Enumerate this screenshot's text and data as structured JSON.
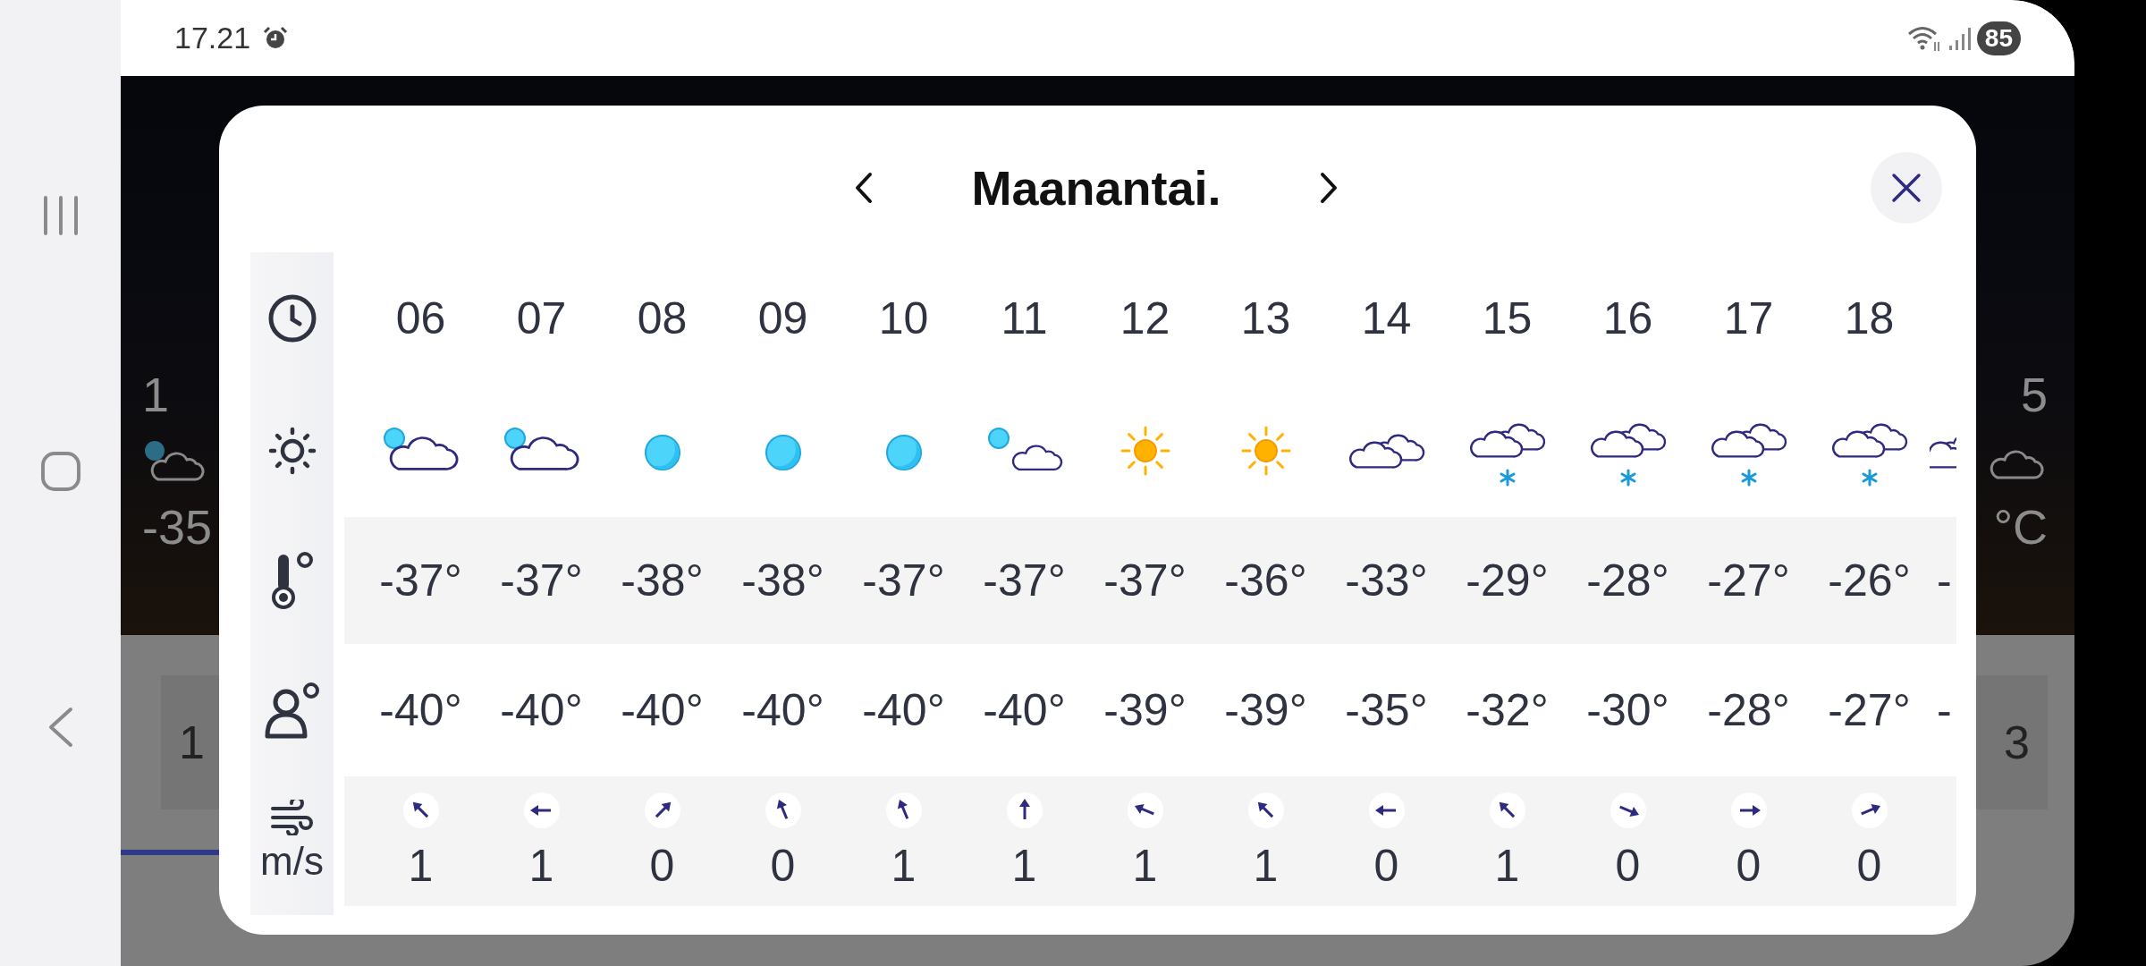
{
  "status_bar": {
    "time": "17.21",
    "battery": "85"
  },
  "background_app": {
    "left_hour": "1",
    "left_temperature": "-35",
    "left_tile": "1",
    "right_hour": "5",
    "right_temperature": "°C",
    "right_tile": "3"
  },
  "dialog": {
    "title": "Maanantai.",
    "wind_unit": "m/s",
    "columns": [
      {
        "hour": "06",
        "kind": "partly-cloudy",
        "temperature": "-37°",
        "feels_like": "-40°",
        "wind": {
          "kind": "nw",
          "speed": "1"
        }
      },
      {
        "hour": "07",
        "kind": "partly-cloudy",
        "temperature": "-37°",
        "feels_like": "-40°",
        "wind": {
          "kind": "w",
          "speed": "1"
        }
      },
      {
        "hour": "08",
        "kind": "clear",
        "temperature": "-38°",
        "feels_like": "-40°",
        "wind": {
          "kind": "ne",
          "speed": "0"
        }
      },
      {
        "hour": "09",
        "kind": "clear",
        "temperature": "-38°",
        "feels_like": "-40°",
        "wind": {
          "kind": "nnw",
          "speed": "0"
        }
      },
      {
        "hour": "10",
        "kind": "clear",
        "temperature": "-37°",
        "feels_like": "-40°",
        "wind": {
          "kind": "nnw",
          "speed": "1"
        }
      },
      {
        "hour": "11",
        "kind": "mostly-clear",
        "temperature": "-37°",
        "feels_like": "-40°",
        "wind": {
          "kind": "n",
          "speed": "1"
        }
      },
      {
        "hour": "12",
        "kind": "sunny",
        "temperature": "-37°",
        "feels_like": "-39°",
        "wind": {
          "kind": "wnw",
          "speed": "1"
        }
      },
      {
        "hour": "13",
        "kind": "sunny",
        "temperature": "-36°",
        "feels_like": "-39°",
        "wind": {
          "kind": "nw",
          "speed": "1"
        }
      },
      {
        "hour": "14",
        "kind": "cloudy",
        "temperature": "-33°",
        "feels_like": "-35°",
        "wind": {
          "kind": "w",
          "speed": "0"
        }
      },
      {
        "hour": "15",
        "kind": "snow",
        "temperature": "-29°",
        "feels_like": "-32°",
        "wind": {
          "kind": "nw",
          "speed": "1"
        }
      },
      {
        "hour": "16",
        "kind": "snow",
        "temperature": "-28°",
        "feels_like": "-30°",
        "wind": {
          "kind": "ese",
          "speed": "0"
        }
      },
      {
        "hour": "17",
        "kind": "snow",
        "temperature": "-27°",
        "feels_like": "-28°",
        "wind": {
          "kind": "e",
          "speed": "0"
        }
      },
      {
        "hour": "18",
        "kind": "snow",
        "temperature": "-26°",
        "feels_like": "-27°",
        "wind": {
          "kind": "ene",
          "speed": "0"
        }
      }
    ],
    "partial_column": {
      "kind": "cloudy",
      "temperature": "-",
      "feels_like": "-"
    }
  }
}
